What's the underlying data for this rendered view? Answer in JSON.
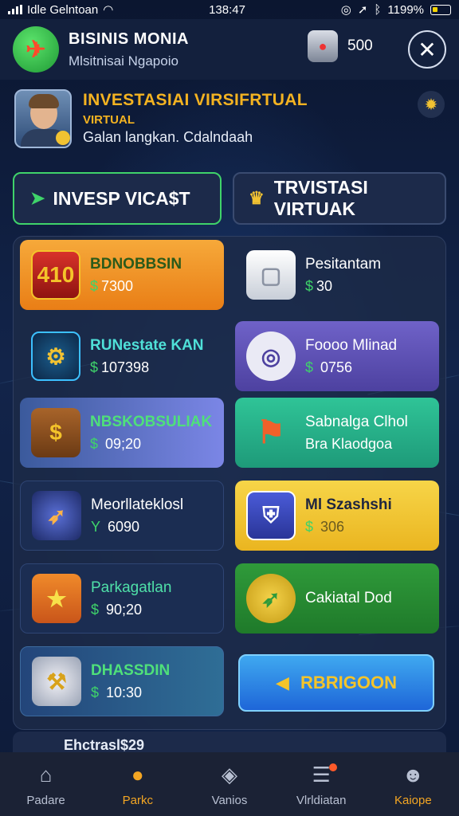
{
  "status_bar": {
    "carrier": "Idle Gelntoan",
    "time": "138:47",
    "battery": "1199%"
  },
  "header": {
    "title": "BISINIS MONIA",
    "subtitle": "Mlsitnisai Ngapoio",
    "coins": "500"
  },
  "profile": {
    "title": "INVESTASIAI VIRSIFRTUAL",
    "tag": "VIRTUAL",
    "desc": "Galan langkan. Cdalndaah"
  },
  "tabs": {
    "invest": "INVESP VICA$T",
    "virtual": "TRVISTASI VIRTUAK"
  },
  "cards": [
    {
      "name": "BDNOBBSIN",
      "price": "$7300",
      "icon_label": "410",
      "icon": "shield-badge-icon"
    },
    {
      "name": "Pesitantam",
      "price": "$30",
      "icon": "box-icon"
    },
    {
      "name": "RUNestate KAN",
      "price": "$107398",
      "icon": "gears-icon"
    },
    {
      "name": "Foooo Mlinad",
      "price": "$ 0756",
      "icon": "target-icon"
    },
    {
      "name": "NBSKOBSULIAK",
      "price": "$ 09;20",
      "icon_label": "$",
      "icon": "money-bag-icon"
    },
    {
      "name": "Sabnalga Clhol",
      "price": "Bra Klaodgoa",
      "icon": "flag-pin-icon"
    },
    {
      "name": "Meorllateklosl",
      "price": "Y 6090",
      "icon": "rocket-icon"
    },
    {
      "name": "Ml Szashshi",
      "price": "$ 306",
      "icon": "shield-icon"
    },
    {
      "name": "Parkagatlan",
      "price": "$ 90;20",
      "icon": "star-shield-icon"
    },
    {
      "name": "Cakiatal Dod",
      "price": "",
      "icon": "rocket-ring-icon"
    },
    {
      "name": "DHASSDIN",
      "price": "$ 10:30",
      "icon": "tool-icon"
    },
    {
      "name": "RBRIGOON",
      "price": "",
      "icon": "arrow-icon"
    }
  ],
  "peek_text": "Ehctrasl$29",
  "nav": [
    {
      "label": "Padare",
      "icon": "home-icon"
    },
    {
      "label": "Parkc",
      "icon": "chat-icon"
    },
    {
      "label": "Vanios",
      "icon": "cube-icon"
    },
    {
      "label": "Vlrldiatan",
      "icon": "list-icon"
    },
    {
      "label": "Kaiope",
      "icon": "people-icon"
    }
  ],
  "colors": {
    "accent": "#f4a623",
    "green": "#3fd36a",
    "background": "#0e1a33"
  }
}
